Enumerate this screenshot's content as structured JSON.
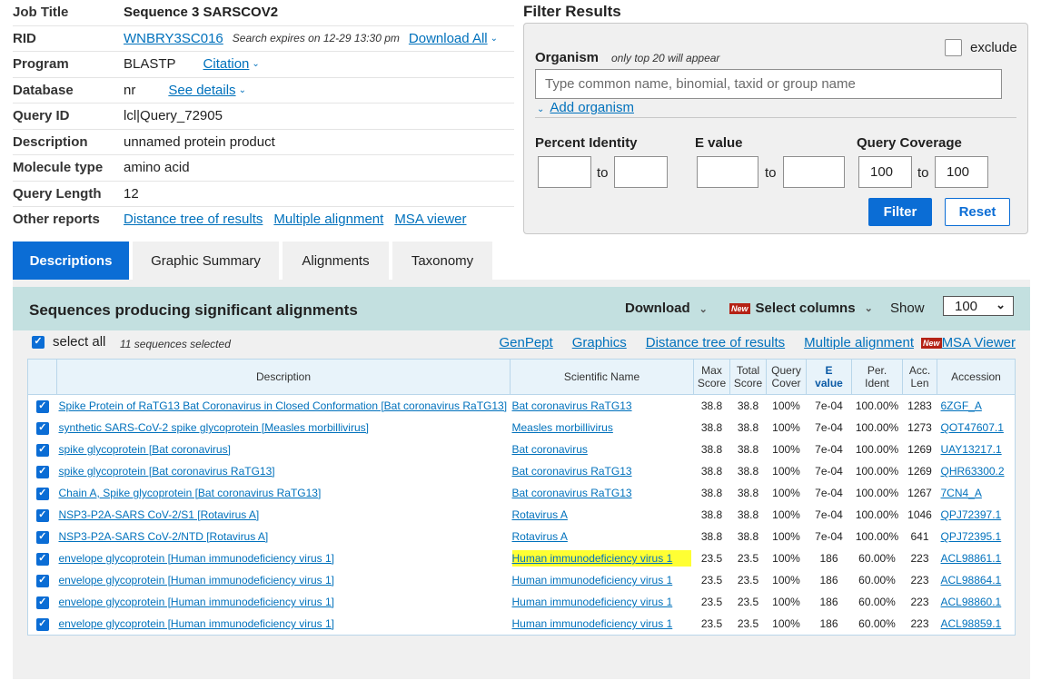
{
  "job_info": {
    "rows": [
      {
        "label": "Job Title",
        "value": "Sequence 3 SARSCOV2"
      },
      {
        "label": "RID",
        "value": "WNBRY3SC016",
        "note": "Search expires on 12-29 13:30 pm",
        "link": "Download All"
      },
      {
        "label": "Program",
        "value": "BLASTP",
        "link": "Citation"
      },
      {
        "label": "Database",
        "value": "nr",
        "link": "See details"
      },
      {
        "label": "Query ID",
        "value": "lcl|Query_72905"
      },
      {
        "label": "Description",
        "value": "unnamed protein product"
      },
      {
        "label": "Molecule type",
        "value": "amino acid"
      },
      {
        "label": "Query Length",
        "value": "12"
      },
      {
        "label": "Other reports",
        "links": [
          "Distance tree of results",
          "Multiple alignment",
          "MSA viewer"
        ]
      }
    ]
  },
  "filter": {
    "title": "Filter Results",
    "organism_label": "Organism",
    "organism_note": "only top 20 will appear",
    "exclude_label": "exclude",
    "organism_placeholder": "Type common  name, binomial, taxid or group  name",
    "add_organism": "Add organism",
    "percent_identity_label": "Percent Identity",
    "evalue_label": "E value",
    "query_coverage_label": "Query Coverage",
    "to_label": "to",
    "query_coverage_from": "100",
    "query_coverage_to": "100",
    "filter_button": "Filter",
    "reset_button": "Reset"
  },
  "tabs": [
    {
      "label": "Descriptions",
      "active": true
    },
    {
      "label": "Graphic Summary",
      "active": false
    },
    {
      "label": "Alignments",
      "active": false
    },
    {
      "label": "Taxonomy",
      "active": false
    }
  ],
  "results": {
    "title": "Sequences producing significant alignments",
    "download": "Download",
    "new_badge": "New",
    "select_columns": "Select columns",
    "show_label": "Show",
    "show_value": "100",
    "select_all": "select all",
    "selected_count": "11 sequences selected",
    "links": [
      "GenPept",
      "Graphics",
      "Distance tree of results",
      "Multiple alignment"
    ],
    "msa_viewer": "MSA Viewer",
    "columns": {
      "description": "Description",
      "scientific_name": "Scientific Name",
      "max_score": [
        "Max",
        "Score"
      ],
      "total_score": [
        "Total",
        "Score"
      ],
      "query_cover": [
        "Query",
        "Cover"
      ],
      "evalue": [
        "E",
        "value"
      ],
      "per_ident": [
        "Per.",
        "Ident"
      ],
      "acc_len": [
        "Acc.",
        "Len"
      ],
      "accession": "Accession"
    },
    "rows": [
      {
        "description": "Spike Protein of RaTG13 Bat Coronavirus in Closed Conformation [Bat coronavirus RaTG13]",
        "scientific_name": "Bat coronavirus RaTG13",
        "max_score": "38.8",
        "total_score": "38.8",
        "query_cover": "100%",
        "evalue": "7e-04",
        "per_ident": "100.00%",
        "acc_len": "1283",
        "accession": "6ZGF_A",
        "highlight": false
      },
      {
        "description": "synthetic SARS-CoV-2 spike glycoprotein [Measles morbillivirus]",
        "scientific_name": "Measles morbillivirus",
        "max_score": "38.8",
        "total_score": "38.8",
        "query_cover": "100%",
        "evalue": "7e-04",
        "per_ident": "100.00%",
        "acc_len": "1273",
        "accession": "QOT47607.1",
        "highlight": false
      },
      {
        "description": "spike glycoprotein [Bat coronavirus]",
        "scientific_name": "Bat coronavirus",
        "max_score": "38.8",
        "total_score": "38.8",
        "query_cover": "100%",
        "evalue": "7e-04",
        "per_ident": "100.00%",
        "acc_len": "1269",
        "accession": "UAY13217.1",
        "highlight": false
      },
      {
        "description": "spike glycoprotein [Bat coronavirus RaTG13]",
        "scientific_name": "Bat coronavirus RaTG13",
        "max_score": "38.8",
        "total_score": "38.8",
        "query_cover": "100%",
        "evalue": "7e-04",
        "per_ident": "100.00%",
        "acc_len": "1269",
        "accession": "QHR63300.2",
        "highlight": false
      },
      {
        "description": "Chain A, Spike glycoprotein [Bat coronavirus RaTG13]",
        "scientific_name": "Bat coronavirus RaTG13",
        "max_score": "38.8",
        "total_score": "38.8",
        "query_cover": "100%",
        "evalue": "7e-04",
        "per_ident": "100.00%",
        "acc_len": "1267",
        "accession": "7CN4_A",
        "highlight": false
      },
      {
        "description": "NSP3-P2A-SARS CoV-2/S1 [Rotavirus A]",
        "scientific_name": "Rotavirus A",
        "max_score": "38.8",
        "total_score": "38.8",
        "query_cover": "100%",
        "evalue": "7e-04",
        "per_ident": "100.00%",
        "acc_len": "1046",
        "accession": "QPJ72397.1",
        "highlight": false
      },
      {
        "description": "NSP3-P2A-SARS CoV-2/NTD [Rotavirus A]",
        "scientific_name": "Rotavirus A",
        "max_score": "38.8",
        "total_score": "38.8",
        "query_cover": "100%",
        "evalue": "7e-04",
        "per_ident": "100.00%",
        "acc_len": "641",
        "accession": "QPJ72395.1",
        "highlight": false
      },
      {
        "description": "envelope glycoprotein [Human immunodeficiency virus 1]",
        "scientific_name": "Human immunodeficiency virus 1",
        "max_score": "23.5",
        "total_score": "23.5",
        "query_cover": "100%",
        "evalue": "186",
        "per_ident": "60.00%",
        "acc_len": "223",
        "accession": "ACL98861.1",
        "highlight": true
      },
      {
        "description": "envelope glycoprotein [Human immunodeficiency virus 1]",
        "scientific_name": "Human immunodeficiency virus 1",
        "max_score": "23.5",
        "total_score": "23.5",
        "query_cover": "100%",
        "evalue": "186",
        "per_ident": "60.00%",
        "acc_len": "223",
        "accession": "ACL98864.1",
        "highlight": false
      },
      {
        "description": "envelope glycoprotein [Human immunodeficiency virus 1]",
        "scientific_name": "Human immunodeficiency virus 1",
        "max_score": "23.5",
        "total_score": "23.5",
        "query_cover": "100%",
        "evalue": "186",
        "per_ident": "60.00%",
        "acc_len": "223",
        "accession": "ACL98860.1",
        "highlight": false
      },
      {
        "description": "envelope glycoprotein [Human immunodeficiency virus 1]",
        "scientific_name": "Human immunodeficiency virus 1",
        "max_score": "23.5",
        "total_score": "23.5",
        "query_cover": "100%",
        "evalue": "186",
        "per_ident": "60.00%",
        "acc_len": "223",
        "accession": "ACL98859.1",
        "highlight": false
      }
    ]
  },
  "colors": {
    "accent": "#0b6dd5",
    "link": "#0071bc",
    "results_header_bg": "#c3e0e0",
    "highlight": "#ffff33",
    "new_badge": "#b52215"
  }
}
